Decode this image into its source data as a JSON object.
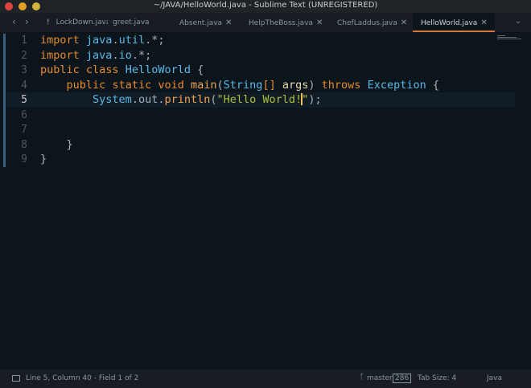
{
  "window": {
    "title": "~/JAVA/HelloWorld.java - Sublime Text (UNREGISTERED)"
  },
  "tabs": [
    {
      "label": "LockDown.java",
      "mark": "!",
      "active": false
    },
    {
      "label": "greet.java",
      "active": false
    },
    {
      "label": "Absent.java",
      "active": false
    },
    {
      "label": "HelpTheBoss.java",
      "active": false
    },
    {
      "label": "ChefLaddus.java",
      "active": false
    },
    {
      "label": "HelloWorld.java",
      "active": true
    }
  ],
  "editor": {
    "line_numbers": [
      "1",
      "2",
      "3",
      "4",
      "5",
      "6",
      "7",
      "8",
      "9"
    ],
    "current_line": 5
  },
  "statusbar": {
    "position": "Line 5, Column 40 - Field 1 of 2",
    "branch": "master",
    "changes": "286",
    "tab_size": "Tab Size: 4",
    "syntax": "Java"
  },
  "colors": {
    "keyword": "#e58a2f",
    "type": "#59b9e6",
    "string": "#a7c23b",
    "tab_accent": "#d9773a",
    "background": "#0d151c"
  }
}
